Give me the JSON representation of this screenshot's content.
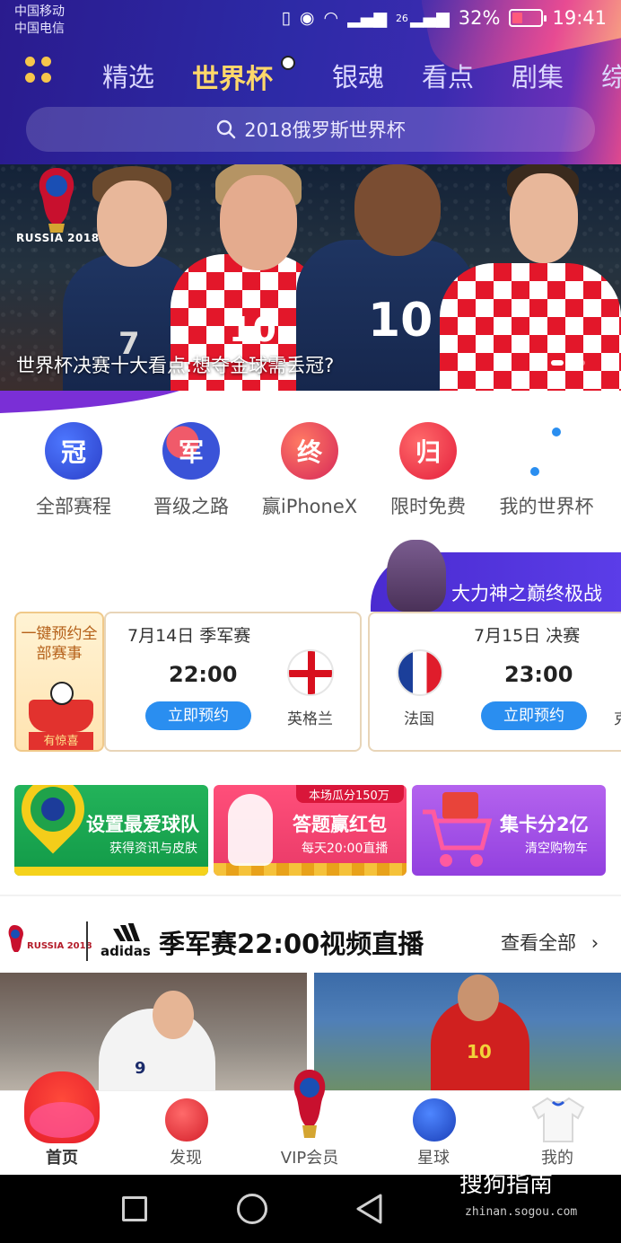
{
  "status_bar": {
    "carrier1": "中国移动",
    "carrier2": "中国电信",
    "signal_label": "26",
    "battery": "32%",
    "time": "19:41"
  },
  "nav": {
    "tabs": [
      {
        "label": "精选",
        "active": false
      },
      {
        "label": "世界杯",
        "active": true
      },
      {
        "label": "银魂",
        "active": false
      },
      {
        "label": "看点",
        "active": false
      },
      {
        "label": "剧集",
        "active": false
      },
      {
        "label": "综",
        "active": false
      }
    ],
    "search_placeholder": "2018俄罗斯世界杯"
  },
  "banner": {
    "caption": "世界杯决赛十大看点:想夺金球需丢冠?",
    "logo_text": "RUSSIA 2018",
    "jersey_numbers": [
      "7",
      "10",
      "10"
    ]
  },
  "quick_links": [
    {
      "label": "全部赛程",
      "icon_char": "冠",
      "color": "#2b4fd8"
    },
    {
      "label": "晋级之路",
      "icon_char": "军",
      "color": "#3a53d8"
    },
    {
      "label": "赢iPhoneX",
      "icon_char": "终",
      "color": "#e63a58"
    },
    {
      "label": "限时免费",
      "icon_char": "归",
      "color": "#ee2f4a"
    },
    {
      "label": "我的世界杯",
      "icon_char": "",
      "color": "#2a8ef0"
    }
  ],
  "promo_tag": {
    "text": "大力神之巅终极战"
  },
  "reserve_card": {
    "title": "一键预约全部赛事",
    "tag": "有惊喜"
  },
  "matches": [
    {
      "date": "7月14日 季军赛",
      "time": "22:00",
      "button": "立即预约",
      "team": "英格兰"
    },
    {
      "date": "7月15日 决赛",
      "time": "23:00",
      "button": "立即预约",
      "team": "法国",
      "team2_fragment": "克"
    }
  ],
  "tiles": [
    {
      "title": "设置最爱球队",
      "sub": "获得资讯与皮肤"
    },
    {
      "title": "答题赢红包",
      "sub": "每天20:00直播",
      "badge": "本场瓜分150万"
    },
    {
      "title": "集卡分2亿",
      "sub": "清空购物车"
    }
  ],
  "live": {
    "wc_text": "RUSSIA 2018",
    "sponsor": "adidas",
    "title": "季军赛22:00视频直播",
    "more": "查看全部"
  },
  "bottom_tabs": [
    {
      "label": "首页",
      "active": true
    },
    {
      "label": "发现",
      "active": false
    },
    {
      "label": "VIP会员",
      "active": false
    },
    {
      "label": "星球",
      "active": false
    },
    {
      "label": "我的",
      "active": false
    }
  ],
  "watermark": {
    "brand": "搜狗指南",
    "url": "zhinan.sogou.com"
  },
  "colors": {
    "header": "#2d2aa6",
    "active_tab": "#ffd86a",
    "button_blue": "#2a8ef0"
  }
}
